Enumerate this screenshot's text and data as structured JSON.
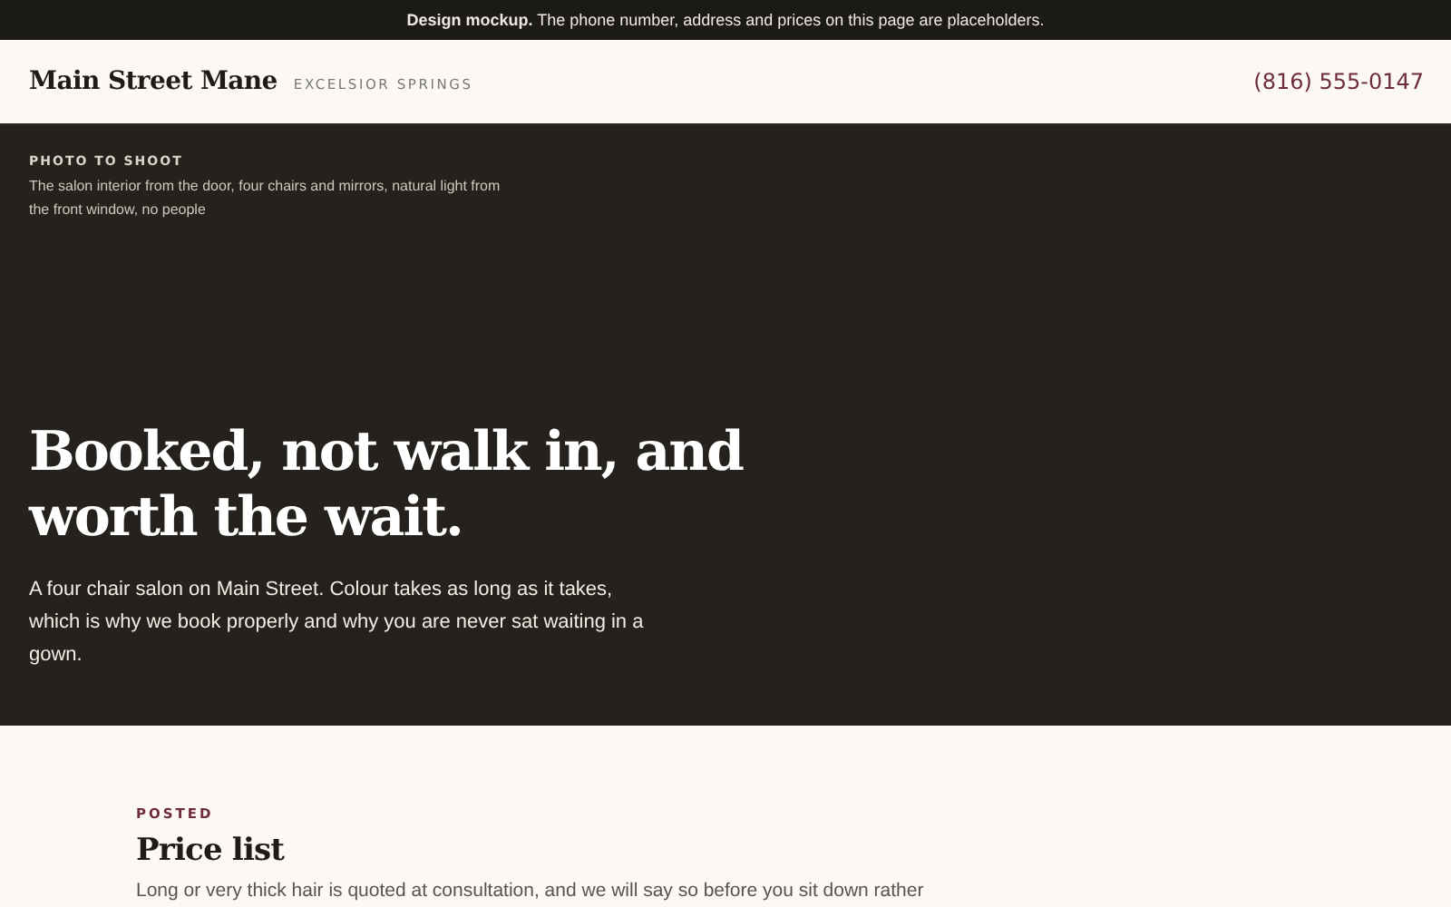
{
  "notice": "**Design mockup.** The phone number, address and prices on this page are placeholders.",
  "header": {
    "brand": "Main Street Mane",
    "location": "EXCELSIOR SPRINGS",
    "phone": "(816) 555-0147"
  },
  "hero": {
    "photo_label": "PHOTO TO SHOOT",
    "photo_note": "The salon interior from the door, four chairs and mirrors, natural light from the front window, no people",
    "headline": "Booked, not walk in, and worth the wait.",
    "intro": "A four chair salon on Main Street. Colour takes as long as it takes, which is why we book properly and why you are never sat waiting in a gown."
  },
  "prices": {
    "eyebrow": "POSTED",
    "title": "Price list",
    "text": "Long or very thick hair is quoted at consultation, and we will say so before you sit down rather"
  }
}
